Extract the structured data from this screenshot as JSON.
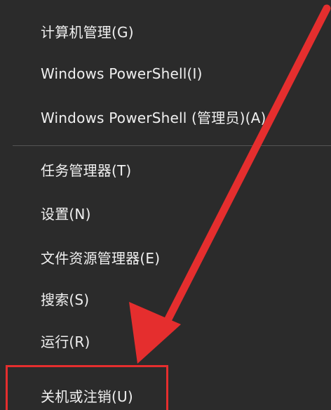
{
  "menu": {
    "items": [
      {
        "label": "计算机管理(G)"
      },
      {
        "label": "Windows PowerShell(I)"
      },
      {
        "label": "Windows PowerShell (管理员)(A)"
      },
      {
        "label": "任务管理器(T)"
      },
      {
        "label": "设置(N)"
      },
      {
        "label": "文件资源管理器(E)"
      },
      {
        "label": "搜索(S)"
      },
      {
        "label": "运行(R)"
      },
      {
        "label": "关机或注销(U)"
      }
    ]
  },
  "colors": {
    "background": "#2b2b2b",
    "text": "#f0f0f0",
    "separator": "#555555",
    "annotation": "#e52e2e"
  },
  "icons": {
    "annotation_arrow": "red-arrow-icon"
  }
}
